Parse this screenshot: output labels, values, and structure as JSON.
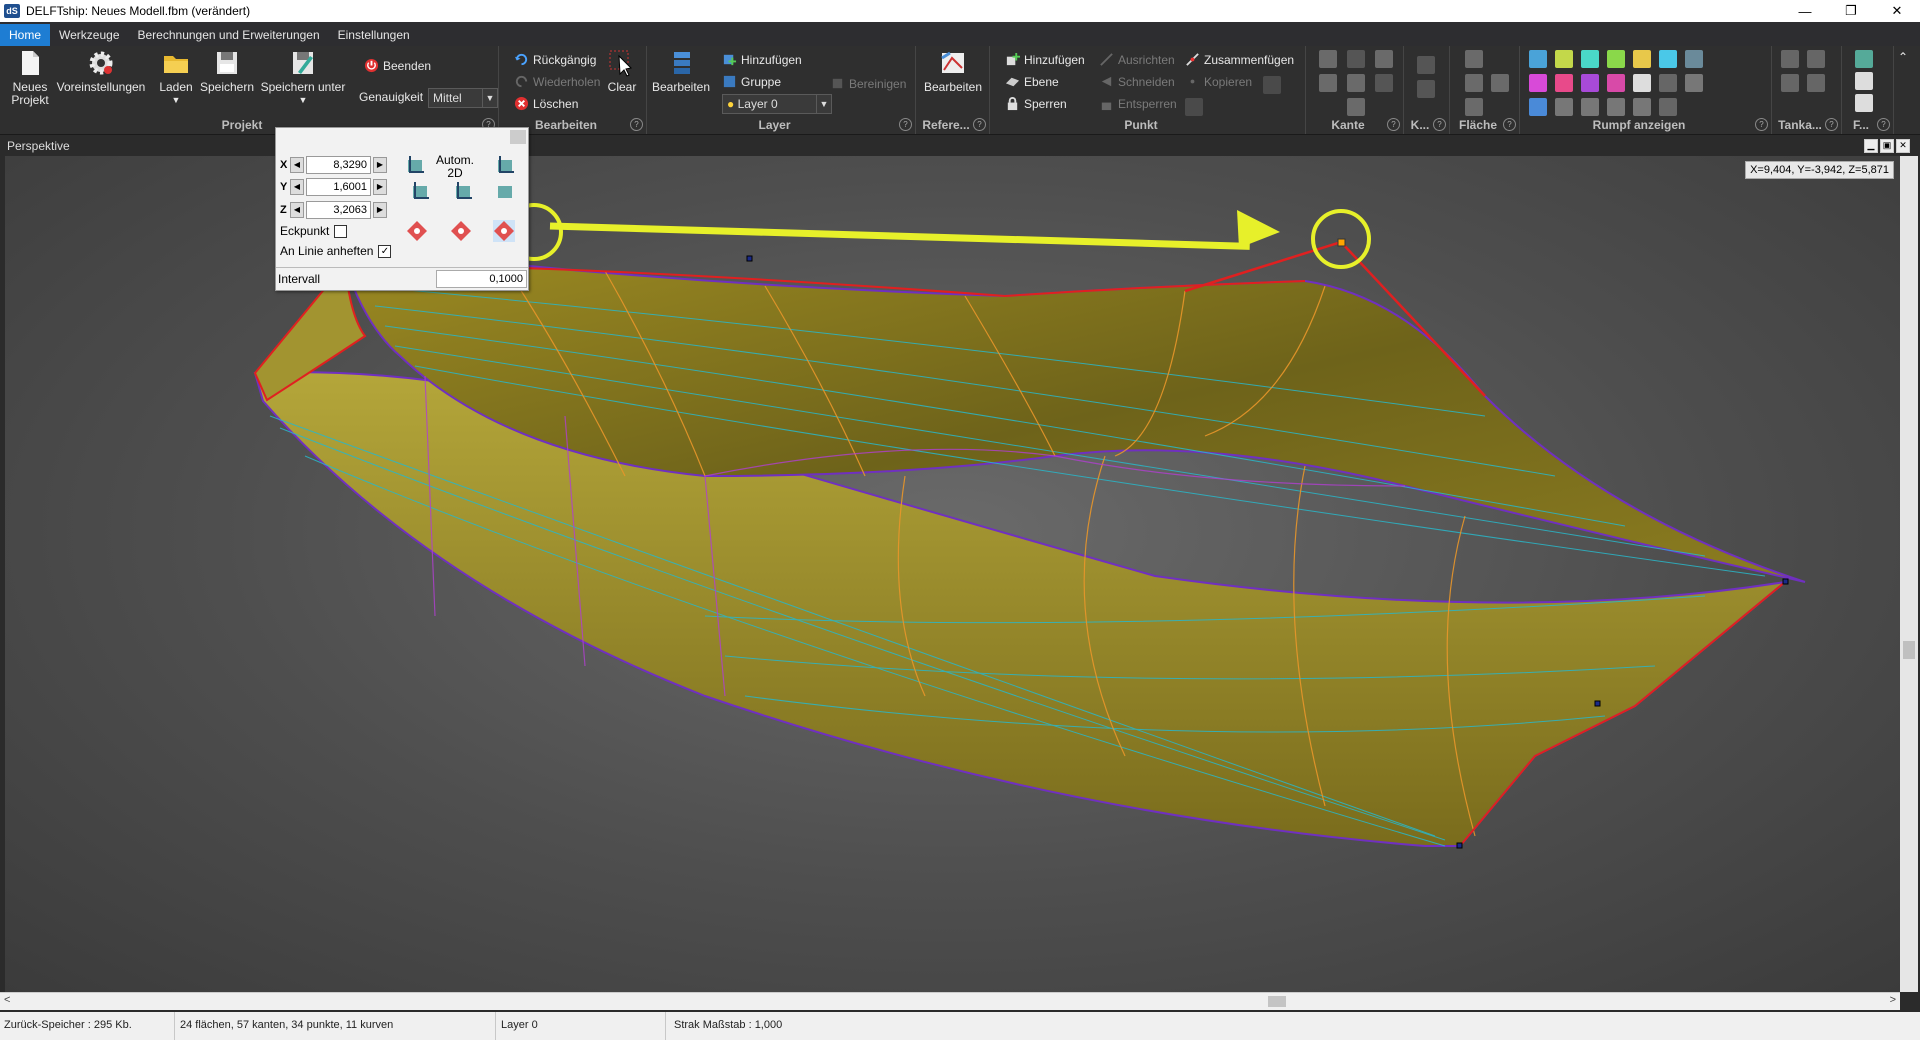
{
  "window": {
    "title": "DELFTship: Neues Modell.fbm (verändert)",
    "app_icon": "dS",
    "controls": [
      "—",
      "❐",
      "✕"
    ]
  },
  "tabs": [
    {
      "label": "Home",
      "active": true
    },
    {
      "label": "Werkzeuge"
    },
    {
      "label": "Berechnungen und Erweiterungen"
    },
    {
      "label": "Einstellungen"
    }
  ],
  "ribbon": {
    "projekt": {
      "label": "Projekt",
      "new": "Neues\nProjekt",
      "prefs": "Voreinstellungen",
      "load": "Laden",
      "save": "Speichern",
      "save_as": "Speichern unter",
      "quit": "Beenden",
      "precision_label": "Genauigkeit",
      "precision_value": "Mittel"
    },
    "bearbeiten": {
      "label": "Bearbeiten",
      "undo": "Rückgängig",
      "redo": "Wiederholen",
      "delete": "Löschen",
      "clear": "Clear"
    },
    "layer": {
      "label": "Layer",
      "edit": "Bearbeiten",
      "add": "Hinzufügen",
      "group": "Gruppe",
      "layer_value": "Layer 0",
      "clean": "Bereinigen"
    },
    "reference": {
      "label": "Refere...",
      "edit": "Bearbeiten"
    },
    "punkt": {
      "label": "Punkt",
      "add": "Hinzufügen",
      "plane": "Ebene",
      "lock": "Sperren",
      "align": "Ausrichten",
      "cut": "Schneiden",
      "unlock": "Entsperren",
      "merge": "Zusammenfügen",
      "copy": "Kopieren"
    },
    "kante": {
      "label": "Kante"
    },
    "k": {
      "label": "K..."
    },
    "flaeche": {
      "label": "Fläche"
    },
    "rumpf": {
      "label": "Rumpf anzeigen"
    },
    "tank": {
      "label": "Tanka..."
    },
    "f": {
      "label": "F..."
    }
  },
  "viewport": {
    "title": "Perspektive",
    "coords": "X=9,404, Y=-3,942, Z=5,871"
  },
  "point_dialog": {
    "x_label": "X",
    "x_value": "8,3290",
    "y_label": "Y",
    "y_value": "1,6001",
    "z_label": "Z",
    "z_value": "3,2063",
    "auto_label": "Autom.",
    "mode_label": "2D",
    "corner_label": "Eckpunkt",
    "corner_checked": false,
    "snap_label": "An Linie anheften",
    "snap_checked": true,
    "interval_label": "Intervall",
    "interval_value": "0,1000"
  },
  "statusbar": {
    "undo_memory": "Zurück-Speicher : 295 Kb.",
    "counts": "24 flächen, 57 kanten, 34 punkte, 11 kurven",
    "layer": "Layer 0",
    "scale": "Strak Maßstab : 1,000"
  },
  "colors": {
    "accent": "#1e7dd3",
    "highlight": "#e7f02a",
    "hull_fill": "#8a7a1a",
    "hull_edge": "#e02020"
  }
}
